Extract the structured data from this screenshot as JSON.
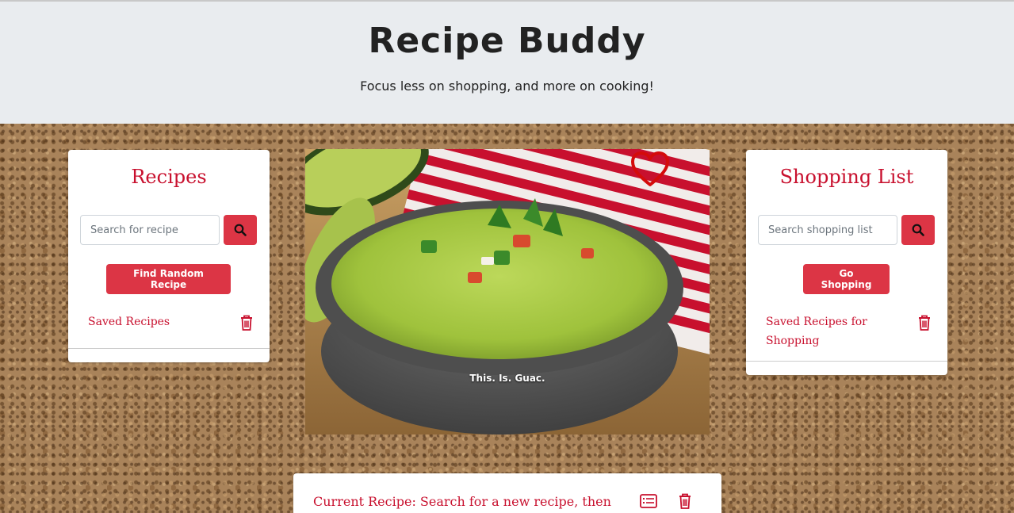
{
  "header": {
    "title": "Recipe Buddy",
    "tagline": "Focus less on shopping, and more on cooking!"
  },
  "recipes_panel": {
    "title": "Recipes",
    "search_placeholder": "Search for recipe",
    "random_button": "Find Random Recipe",
    "saved_label": "Saved Recipes"
  },
  "hero": {
    "caption": "This. Is. Guac.",
    "favorite_icon": "heart-outline-icon"
  },
  "shopping_panel": {
    "title": "Shopping List",
    "search_placeholder": "Search shopping list",
    "go_button": "Go Shopping",
    "saved_label": "Saved Recipes for Shopping"
  },
  "current_recipe": {
    "label": "Current Recipe: Search for a new recipe, then"
  },
  "colors": {
    "accent": "#dc3545",
    "title_red": "#c8102e",
    "header_bg": "#e9ecef"
  }
}
